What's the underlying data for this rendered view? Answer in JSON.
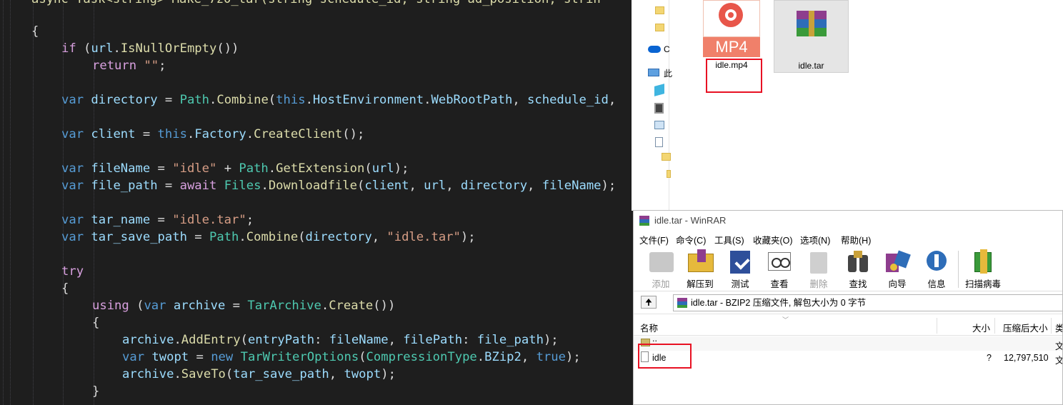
{
  "editor": {
    "lines": [
      [
        [
          "fn",
          "async Task<string> Make_7z0_tar(string schedule_id, string ad_position, strin"
        ]
      ],
      [
        [
          "pl",
          "{"
        ]
      ],
      [
        [
          "ctl",
          "if"
        ],
        [
          "pl",
          " ("
        ],
        [
          "var",
          "url"
        ],
        [
          "pl",
          "."
        ],
        [
          "fn",
          "IsNullOrEmpty"
        ],
        [
          "pl",
          "())"
        ]
      ],
      [
        [
          "ctl",
          "return"
        ],
        [
          "pl",
          " "
        ],
        [
          "str",
          "\"\""
        ],
        [
          "pl",
          ";"
        ]
      ],
      [],
      [
        [
          "kw",
          "var"
        ],
        [
          "pl",
          " "
        ],
        [
          "var",
          "directory"
        ],
        [
          "pl",
          " = "
        ],
        [
          "typ",
          "Path"
        ],
        [
          "pl",
          "."
        ],
        [
          "fn",
          "Combine"
        ],
        [
          "pl",
          "("
        ],
        [
          "kw",
          "this"
        ],
        [
          "pl",
          "."
        ],
        [
          "var",
          "HostEnvironment"
        ],
        [
          "pl",
          "."
        ],
        [
          "var",
          "WebRootPath"
        ],
        [
          "pl",
          ", "
        ],
        [
          "var",
          "schedule_id"
        ],
        [
          "pl",
          ","
        ]
      ],
      [],
      [
        [
          "kw",
          "var"
        ],
        [
          "pl",
          " "
        ],
        [
          "var",
          "client"
        ],
        [
          "pl",
          " = "
        ],
        [
          "kw",
          "this"
        ],
        [
          "pl",
          "."
        ],
        [
          "var",
          "Factory"
        ],
        [
          "pl",
          "."
        ],
        [
          "fn",
          "CreateClient"
        ],
        [
          "pl",
          "();"
        ]
      ],
      [],
      [
        [
          "kw",
          "var"
        ],
        [
          "pl",
          " "
        ],
        [
          "var",
          "fileName"
        ],
        [
          "pl",
          " = "
        ],
        [
          "str",
          "\"idle\""
        ],
        [
          "pl",
          " + "
        ],
        [
          "typ",
          "Path"
        ],
        [
          "pl",
          "."
        ],
        [
          "fn",
          "GetExtension"
        ],
        [
          "pl",
          "("
        ],
        [
          "var",
          "url"
        ],
        [
          "pl",
          ");"
        ]
      ],
      [
        [
          "kw",
          "var"
        ],
        [
          "pl",
          " "
        ],
        [
          "var",
          "file_path"
        ],
        [
          "pl",
          " = "
        ],
        [
          "ctl",
          "await"
        ],
        [
          "pl",
          " "
        ],
        [
          "typ",
          "Files"
        ],
        [
          "pl",
          "."
        ],
        [
          "fn",
          "Downloadfile"
        ],
        [
          "pl",
          "("
        ],
        [
          "var",
          "client"
        ],
        [
          "pl",
          ", "
        ],
        [
          "var",
          "url"
        ],
        [
          "pl",
          ", "
        ],
        [
          "var",
          "directory"
        ],
        [
          "pl",
          ", "
        ],
        [
          "var",
          "fileName"
        ],
        [
          "pl",
          ");"
        ]
      ],
      [],
      [
        [
          "kw",
          "var"
        ],
        [
          "pl",
          " "
        ],
        [
          "var",
          "tar_name"
        ],
        [
          "pl",
          " = "
        ],
        [
          "str",
          "\"idle.tar\""
        ],
        [
          "pl",
          ";"
        ]
      ],
      [
        [
          "kw",
          "var"
        ],
        [
          "pl",
          " "
        ],
        [
          "var",
          "tar_save_path"
        ],
        [
          "pl",
          " = "
        ],
        [
          "typ",
          "Path"
        ],
        [
          "pl",
          "."
        ],
        [
          "fn",
          "Combine"
        ],
        [
          "pl",
          "("
        ],
        [
          "var",
          "directory"
        ],
        [
          "pl",
          ", "
        ],
        [
          "str",
          "\"idle.tar\""
        ],
        [
          "pl",
          ");"
        ]
      ],
      [],
      [
        [
          "ctl",
          "try"
        ]
      ],
      [
        [
          "pl",
          "{"
        ]
      ],
      [
        [
          "ctl",
          "using"
        ],
        [
          "pl",
          " ("
        ],
        [
          "kw",
          "var"
        ],
        [
          "pl",
          " "
        ],
        [
          "var",
          "archive"
        ],
        [
          "pl",
          " = "
        ],
        [
          "typ",
          "TarArchive"
        ],
        [
          "pl",
          "."
        ],
        [
          "fn",
          "Create"
        ],
        [
          "pl",
          "())"
        ]
      ],
      [
        [
          "pl",
          "{"
        ]
      ],
      [
        [
          "var",
          "archive"
        ],
        [
          "pl",
          "."
        ],
        [
          "fn",
          "AddEntry"
        ],
        [
          "pl",
          "("
        ],
        [
          "var",
          "entryPath"
        ],
        [
          "pl",
          ": "
        ],
        [
          "var",
          "fileName"
        ],
        [
          "pl",
          ", "
        ],
        [
          "var",
          "filePath"
        ],
        [
          "pl",
          ": "
        ],
        [
          "var",
          "file_path"
        ],
        [
          "pl",
          ");"
        ]
      ],
      [
        [
          "kw",
          "var"
        ],
        [
          "pl",
          " "
        ],
        [
          "var",
          "twopt"
        ],
        [
          "pl",
          " = "
        ],
        [
          "kw",
          "new"
        ],
        [
          "pl",
          " "
        ],
        [
          "typ",
          "TarWriterOptions"
        ],
        [
          "pl",
          "("
        ],
        [
          "typ",
          "CompressionType"
        ],
        [
          "pl",
          "."
        ],
        [
          "var",
          "BZip2"
        ],
        [
          "pl",
          ", "
        ],
        [
          "kw",
          "true"
        ],
        [
          "pl",
          ");"
        ]
      ],
      [
        [
          "var",
          "archive"
        ],
        [
          "pl",
          "."
        ],
        [
          "fn",
          "SaveTo"
        ],
        [
          "pl",
          "("
        ],
        [
          "var",
          "tar_save_path"
        ],
        [
          "pl",
          ", "
        ],
        [
          "var",
          "twopt"
        ],
        [
          "pl",
          ");"
        ]
      ],
      [
        [
          "pl",
          "}"
        ]
      ]
    ]
  },
  "explorer": {
    "nav_letters": [
      "C",
      "此"
    ],
    "files": [
      {
        "name": "idle.mp4",
        "badge": "MP4"
      },
      {
        "name": "idle.tar"
      }
    ]
  },
  "winrar": {
    "title": "idle.tar - WinRAR",
    "menu": [
      "文件(F)",
      "命令(C)",
      "工具(S)",
      "收藏夹(O)",
      "选项(N)",
      "帮助(H)"
    ],
    "toolbar": [
      {
        "label": "添加",
        "disabled": true
      },
      {
        "label": "解压到"
      },
      {
        "label": "测试"
      },
      {
        "label": "查看"
      },
      {
        "label": "删除",
        "disabled": true
      },
      {
        "label": "查找"
      },
      {
        "label": "向导"
      },
      {
        "label": "信息"
      },
      {
        "label": "扫描病毒"
      }
    ],
    "path_text": "idle.tar - BZIP2 压缩文件, 解包大小为 0 字节",
    "columns": {
      "name": "名称",
      "size": "大小",
      "packed": "压缩后大小",
      "type": "类"
    },
    "rows": [
      {
        "name": "..",
        "size": "",
        "packed": "",
        "type": "文"
      },
      {
        "name": "idle",
        "size": "?",
        "packed": "12,797,510",
        "type": "文"
      }
    ]
  },
  "colors": {
    "editor_bg": "#1e1e1e",
    "keyword": "#569cd6",
    "control": "#d8a0df",
    "string": "#d69d85",
    "type": "#4ec9b0",
    "method": "#dcdcaa",
    "identifier": "#9cdcfe",
    "highlight_box": "#e81123"
  }
}
